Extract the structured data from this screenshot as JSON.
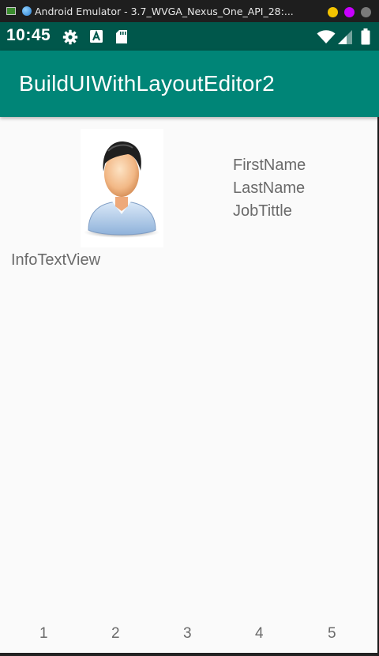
{
  "host_window": {
    "title": "Android Emulator - 3.7_WVGA_Nexus_One_API_28:..."
  },
  "status_bar": {
    "time": "10:45",
    "icons": [
      "gear-icon",
      "a-box-icon",
      "sd-card-icon",
      "wifi-icon",
      "signal-icon",
      "battery-icon"
    ]
  },
  "app_bar": {
    "title": "BuildUIWithLayoutEditor2"
  },
  "content": {
    "avatar_icon": "person-avatar-icon",
    "first_name": "FirstName",
    "last_name": "LastName",
    "job_title": "JobTittle",
    "info_text": "InfoTextView"
  },
  "bottom_numbers": [
    "1",
    "2",
    "3",
    "4",
    "5"
  ],
  "colors": {
    "primary": "#008577",
    "primary_dark": "#00574b",
    "text_secondary": "#6a6a6a",
    "background": "#fafafa"
  }
}
